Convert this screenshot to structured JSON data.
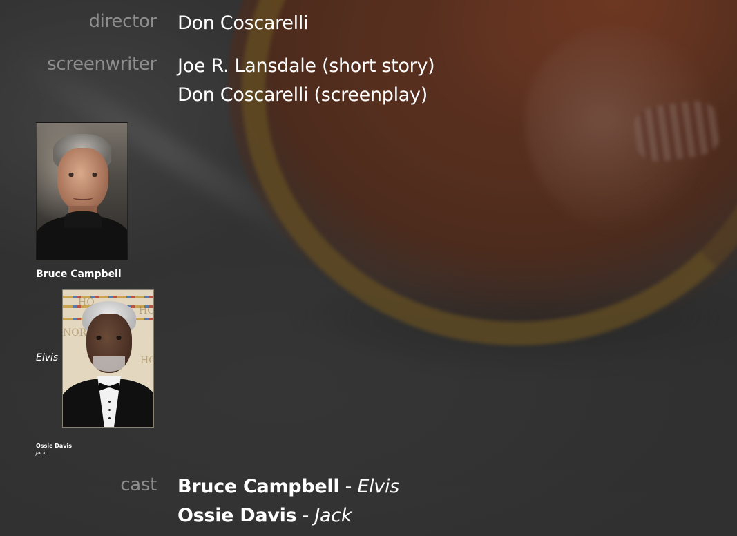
{
  "credits": {
    "director": {
      "label": "director",
      "values": [
        "Don Coscarelli"
      ]
    },
    "screenwriter": {
      "label": "screenwriter",
      "values": [
        "Joe R. Lansdale (short story)",
        "Don Coscarelli (screenplay)"
      ]
    },
    "cast": {
      "label": "cast",
      "members": [
        {
          "actor": "Bruce Campbell",
          "separator": "-",
          "role": "Elvis"
        },
        {
          "actor": "Ossie Davis",
          "separator": "-",
          "role": "Jack"
        }
      ]
    }
  },
  "cast_cards": [
    {
      "name": "Bruce Campbell",
      "role": "Elvis",
      "photo_icon": "actor-headshot-photo"
    },
    {
      "name": "Ossie Davis",
      "role": "Jack",
      "photo_icon": "actor-headshot-photo"
    }
  ],
  "colors": {
    "background": "#3a3a3a",
    "label": "#8d8d8d",
    "value": "#ffffff",
    "poster_accent": "#8b3a1c"
  }
}
